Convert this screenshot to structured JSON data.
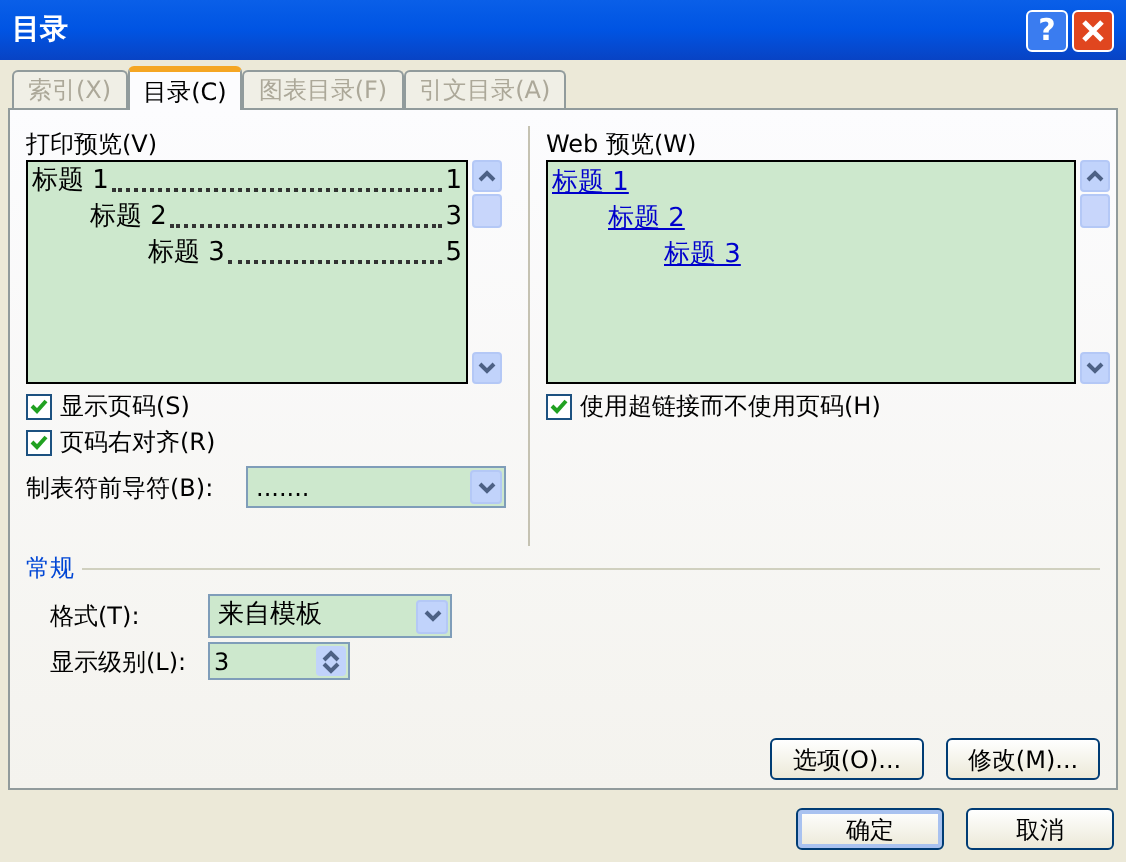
{
  "window": {
    "title": "目录"
  },
  "title_buttons": [
    {
      "kind": "help",
      "label": "?"
    },
    {
      "kind": "close"
    }
  ],
  "tabs": [
    {
      "label": "索引(X)",
      "selected": false,
      "disabled": true
    },
    {
      "label": "目录(C)",
      "selected": true,
      "disabled": false
    },
    {
      "label": "图表目录(F)",
      "selected": false,
      "disabled": true
    },
    {
      "label": "引文目录(A)",
      "selected": false,
      "disabled": true
    }
  ],
  "print_preview": {
    "label": "打印预览(V)",
    "entries": [
      {
        "label": "标题 1",
        "page": "1",
        "children": [
          {
            "label": "标题 2",
            "page": "3",
            "children": [
              {
                "label": "标题 3",
                "page": "5"
              }
            ]
          }
        ]
      }
    ]
  },
  "print_options": [
    {
      "label": "显示页码(S)",
      "checked": true
    },
    {
      "label": "页码右对齐(R)",
      "checked": true
    }
  ],
  "tab_leader": {
    "label": "制表符前导符(B):",
    "value": "......."
  },
  "web_preview": {
    "label": "Web 预览(W)",
    "entries": [
      {
        "label": "标题 1",
        "children": [
          {
            "label": "标题 2",
            "children": [
              {
                "label": "标题 3"
              }
            ]
          }
        ]
      }
    ]
  },
  "web_options": [
    {
      "label": "使用超链接而不使用页码(H)",
      "checked": true
    }
  ],
  "general": {
    "heading": "常规",
    "format": {
      "label": "格式(T):",
      "value": "来自模板"
    },
    "levels": {
      "label": "显示级别(L):",
      "value": "3"
    }
  },
  "panel_buttons": [
    "选项(O)...",
    "修改(M)..."
  ],
  "dialog_buttons": [
    "确定",
    "取消"
  ]
}
